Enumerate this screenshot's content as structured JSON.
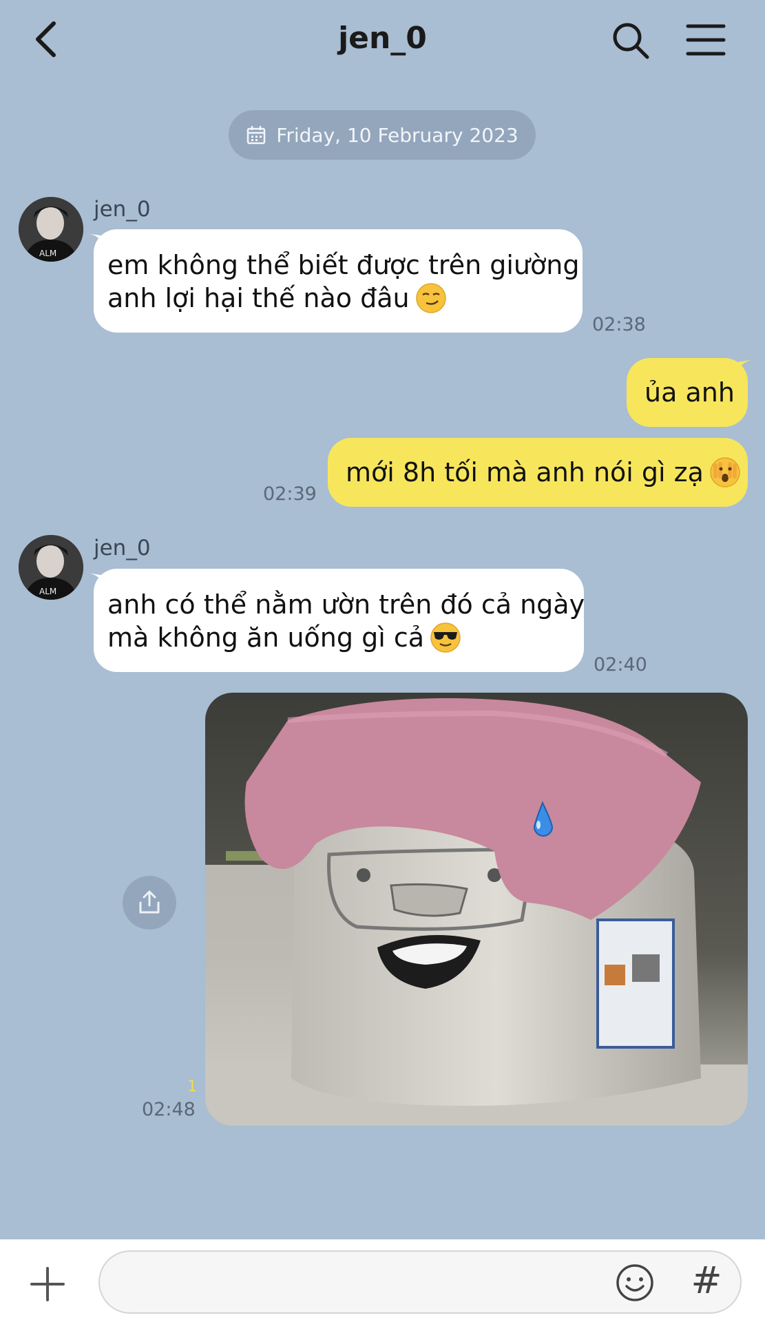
{
  "header": {
    "title": "jen_0",
    "back_icon": "chevron-left-icon",
    "search_icon": "search-icon",
    "menu_icon": "hamburger-menu-icon"
  },
  "date_divider": {
    "text": "Friday, 10 February 2023",
    "icon": "calendar-icon"
  },
  "messages": [
    {
      "direction": "incoming",
      "sender": "jen_0",
      "lines": [
        "em không thể biết được trên giường",
        "anh lợi hại thế nào đâu"
      ],
      "emoji": "smirk-emoji",
      "time": "02:38"
    },
    {
      "direction": "outgoing",
      "lines": [
        "ủa anh"
      ]
    },
    {
      "direction": "outgoing",
      "lines": [
        "mới 8h tối mà anh nói gì zạ"
      ],
      "emoji": "face-peeking-emoji",
      "time": "02:39"
    },
    {
      "direction": "incoming",
      "sender": "jen_0",
      "lines": [
        "anh có thể nằm ườn trên đó cả ngày",
        "mà không ăn uống gì cả"
      ],
      "emoji": "sunglasses-emoji",
      "time": "02:40"
    },
    {
      "direction": "outgoing",
      "type": "image",
      "image_description": "rice cooker with pink towel and drop emoji",
      "read_count": "1",
      "time": "02:48"
    }
  ],
  "composer": {
    "input_value": "",
    "input_placeholder": "",
    "plus_icon": "plus-icon",
    "emoji_icon": "smiley-icon",
    "hashtag_label": "#"
  },
  "colors": {
    "background": "#a9bdd3",
    "incoming_bubble": "#ffffff",
    "outgoing_bubble": "#f7e65b",
    "date_pill": "#93a6bc"
  }
}
